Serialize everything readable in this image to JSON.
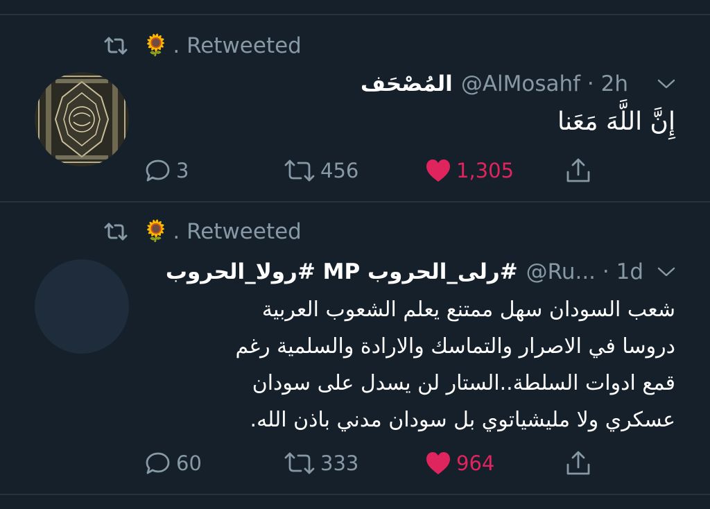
{
  "colors": {
    "background": "#15202b",
    "divider": "#253341",
    "secondary_text": "#8899a6",
    "primary_text": "#ffffff",
    "like": "#e0245e",
    "avatar_placeholder": "#1e2c3b"
  },
  "tweets": [
    {
      "retweet_banner": {
        "emoji": "🌻",
        "text": ". Retweeted"
      },
      "author": {
        "name": "المُصْحَف",
        "handle": "@AlMosahf",
        "time": "2h",
        "meta": "@AlMosahf · 2h"
      },
      "text": "إِنَّ اللَّهَ مَعَنا",
      "counts": {
        "replies": "3",
        "retweets": "456",
        "likes": "1,305"
      },
      "liked": true,
      "icons": [
        "retweet-icon",
        "chevron-down-icon",
        "reply-icon",
        "retweet-icon",
        "heart-icon",
        "share-icon"
      ]
    },
    {
      "retweet_banner": {
        "emoji": "🌻",
        "text": ". Retweeted"
      },
      "author": {
        "name": "#رلى_الحروب MP #رولا_الحروب",
        "handle": "@Ru...",
        "time": "1d",
        "meta": "@Ru... · 1d"
      },
      "text_lines": [
        "شعب السودان سهل ممتنع يعلم الشعوب العربية",
        "دروسا في الاصرار والتماسك والارادة والسلمية رغم",
        "قمع ادوات السلطة..الستار لن يسدل على سودان",
        "عسكري ولا مليشياتوي بل سودان مدني باذن الله."
      ],
      "counts": {
        "replies": "60",
        "retweets": "333",
        "likes": "964"
      },
      "liked": true,
      "icons": [
        "retweet-icon",
        "chevron-down-icon",
        "reply-icon",
        "retweet-icon",
        "heart-icon",
        "share-icon"
      ]
    }
  ]
}
